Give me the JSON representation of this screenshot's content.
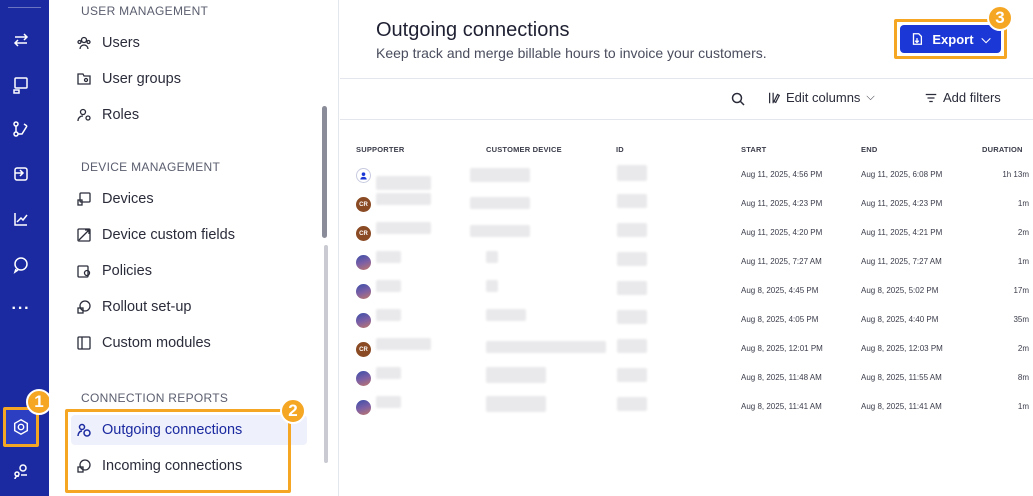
{
  "rail": {
    "icons": [
      "transfer-icon",
      "remote-screen-icon",
      "flow-icon",
      "device-switch-icon",
      "analytics-icon",
      "chat-icon",
      "more-icon",
      "reports-icon",
      "management-icon"
    ],
    "more_label": "···"
  },
  "badges": {
    "one": "1",
    "two": "2",
    "three": "3"
  },
  "sidebar": {
    "user_management_title": "USER MANAGEMENT",
    "user_items": [
      "Users",
      "User groups",
      "Roles"
    ],
    "device_management_title": "DEVICE MANAGEMENT",
    "device_items": [
      "Devices",
      "Device custom fields",
      "Policies",
      "Rollout set-up",
      "Custom modules"
    ],
    "connection_reports_title": "CONNECTION REPORTS",
    "report_items": [
      "Outgoing connections",
      "Incoming connections"
    ]
  },
  "main": {
    "title": "Outgoing connections",
    "subtitle": "Keep track and merge billable hours to invoice your customers.",
    "export_label": "Export",
    "toolbar": {
      "edit_columns": "Edit columns",
      "add_filters": "Add filters"
    },
    "columns": [
      "SUPPORTER",
      "CUSTOMER DEVICE",
      "ID",
      "START",
      "END",
      "DURATION"
    ],
    "rows": [
      {
        "avatar": "user",
        "initials": "",
        "start": "Aug 11, 2025, 4:56 PM",
        "end": "Aug 11, 2025, 6:08 PM",
        "duration": "1h 13m"
      },
      {
        "avatar": "cr",
        "initials": "CR",
        "start": "Aug 11, 2025, 4:23 PM",
        "end": "Aug 11, 2025, 4:23 PM",
        "duration": "1m"
      },
      {
        "avatar": "cr",
        "initials": "CR",
        "start": "Aug 11, 2025, 4:20 PM",
        "end": "Aug 11, 2025, 4:21 PM",
        "duration": "2m"
      },
      {
        "avatar": "img",
        "initials": "",
        "start": "Aug 11, 2025, 7:27 AM",
        "end": "Aug 11, 2025, 7:27 AM",
        "duration": "1m"
      },
      {
        "avatar": "img",
        "initials": "",
        "start": "Aug 8, 2025, 4:45 PM",
        "end": "Aug 8, 2025, 5:02 PM",
        "duration": "17m"
      },
      {
        "avatar": "img",
        "initials": "",
        "start": "Aug 8, 2025, 4:05 PM",
        "end": "Aug 8, 2025, 4:40 PM",
        "duration": "35m"
      },
      {
        "avatar": "cr",
        "initials": "CR",
        "start": "Aug 8, 2025, 12:01 PM",
        "end": "Aug 8, 2025, 12:03 PM",
        "duration": "2m"
      },
      {
        "avatar": "img",
        "initials": "",
        "start": "Aug 8, 2025, 11:48 AM",
        "end": "Aug 8, 2025, 11:55 AM",
        "duration": "8m"
      },
      {
        "avatar": "img",
        "initials": "",
        "start": "Aug 8, 2025, 11:41 AM",
        "end": "Aug 8, 2025, 11:41 AM",
        "duration": "1m"
      }
    ]
  },
  "colors": {
    "rail": "#1b2aa0",
    "accent": "#1b37d6",
    "annotation": "#f5a623",
    "active_bg": "#eef0fb"
  }
}
